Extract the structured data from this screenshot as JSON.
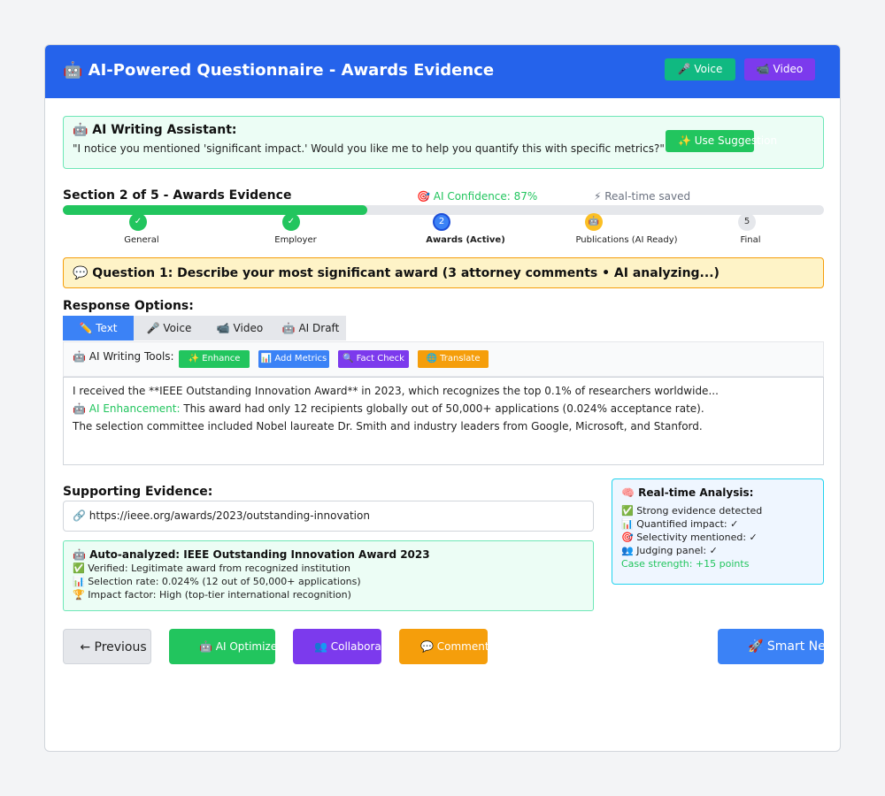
{
  "header": {
    "title": "🤖 AI-Powered Questionnaire - Awards Evidence",
    "voice_label": "🎤 Voice",
    "video_label": "📹 Video",
    "voice_color": "#10b981",
    "video_color": "#7c3aed"
  },
  "assistant": {
    "title": "🤖 AI Writing Assistant:",
    "text": "\"I notice you mentioned 'significant impact.' Would you like me to help you quantify this with specific metrics?\"",
    "button_label": "✨ Use Suggestion"
  },
  "progress": {
    "section_title": "Section 2 of 5 - Awards Evidence",
    "confidence": "🎯 AI Confidence: 87%",
    "saved": "⚡ Real-time saved",
    "fill_fraction": 0.4,
    "steps": [
      {
        "marker": "✓",
        "label": "General",
        "state": "done"
      },
      {
        "marker": "✓",
        "label": "Employer",
        "state": "done"
      },
      {
        "marker": "2",
        "label": "Awards (Active)",
        "state": "active"
      },
      {
        "marker": "🤖",
        "label": "Publications (AI Ready)",
        "state": "ready"
      },
      {
        "marker": "5",
        "label": "Final",
        "state": "pending"
      }
    ]
  },
  "question": {
    "text": "💬 Question 1: Describe your most significant award (3 attorney comments • AI analyzing...)"
  },
  "response": {
    "label": "Response Options:",
    "tabs": [
      "✏️ Text",
      "🎤 Voice",
      "📹 Video",
      "🤖 AI Draft"
    ],
    "active_tab": 0,
    "tools_label": "🤖 AI Writing Tools:",
    "tools": [
      {
        "label": "✨ Enhance",
        "color": "#22c55e"
      },
      {
        "label": "📊 Add Metrics",
        "color": "#3b82f6"
      },
      {
        "label": "🔍 Fact Check",
        "color": "#7c3aed"
      },
      {
        "label": "🌐 Translate",
        "color": "#f59e0b"
      }
    ],
    "line1": "I received the **IEEE Outstanding Innovation Award** in 2023, which recognizes the top 0.1% of researchers worldwide...",
    "line2_icon": "🤖",
    "line2_label": "AI Enhancement:",
    "line2_text": "This award had only 12 recipients globally out of 50,000+ applications (0.024% acceptance rate).",
    "line3": "The selection committee included Nobel laureate Dr. Smith and industry leaders from Google, Microsoft, and Stanford."
  },
  "evidence": {
    "label": "Supporting Evidence:",
    "url": "🔗 https://ieee.org/awards/2023/outstanding-innovation",
    "auto_title": "🤖 Auto-analyzed: IEEE Outstanding Innovation Award 2023",
    "auto_lines": [
      "✅ Verified: Legitimate award from recognized institution",
      "📊 Selection rate: 0.024% (12 out of 50,000+ applications)",
      "🏆 Impact factor: High (top-tier international recognition)"
    ]
  },
  "analysis": {
    "title": "🧠 Real-time Analysis:",
    "lines": [
      "✅ Strong evidence detected",
      "📊 Quantified impact: ✓",
      "🎯 Selectivity mentioned: ✓",
      "👥 Judging panel: ✓"
    ],
    "strength": "Case strength: +15 points"
  },
  "actions": {
    "previous": "← Previous",
    "optimize": "🤖 AI Optimize",
    "collaborate": "👥 Collaborate",
    "comments": "💬 Comments",
    "next": "🚀 Smart Next"
  }
}
